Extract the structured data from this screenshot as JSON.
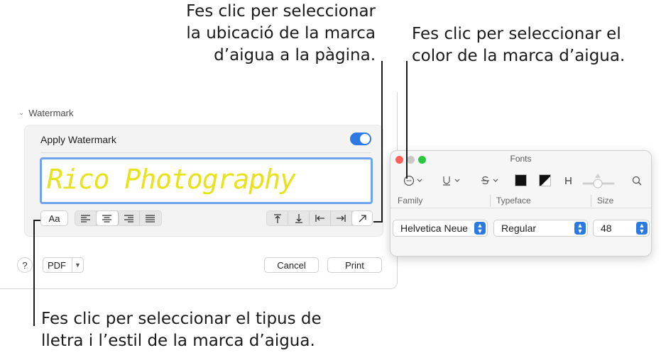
{
  "callouts": {
    "location": [
      "Fes clic per seleccionar",
      "la ubicació de la marca",
      "d’aigua a la pàgina."
    ],
    "color": [
      "Fes clic per seleccionar el",
      "color de la marca d’aigua."
    ],
    "font": [
      "Fes clic per seleccionar el tipus de",
      "lletra i l’estil de la marca d’aigua."
    ]
  },
  "dialog": {
    "section_title": "Watermark",
    "apply_label": "Apply Watermark",
    "apply_on": true,
    "watermark_text": "Rico Photography",
    "watermark_color": "#e8e21c",
    "font_button": "Aa",
    "align_icons": [
      "align-left-icon",
      "align-center-icon",
      "align-right-icon",
      "justify-icon"
    ],
    "align_active": 1,
    "position_icons": [
      "position-top-icon",
      "position-bottom-icon",
      "position-left-icon",
      "position-right-icon",
      "position-diagonal-icon"
    ],
    "position_active": 4,
    "help_label": "?",
    "pdf_label": "PDF",
    "cancel_label": "Cancel",
    "print_label": "Print"
  },
  "fonts_panel": {
    "title": "Fonts",
    "columns": [
      "Family",
      "Typeface",
      "Size"
    ],
    "family": "Helvetica Neue",
    "typeface": "Regular",
    "size": "48",
    "toolbar_icons": [
      "more-actions-icon",
      "underline-icon",
      "strikethrough-icon",
      "text-color-icon",
      "document-color-icon",
      "shadow-icon",
      "shadow-slider-icon",
      "search-icon"
    ],
    "text_color": "#111111",
    "document_color": "#111111",
    "accent": "#2a7ae2"
  }
}
